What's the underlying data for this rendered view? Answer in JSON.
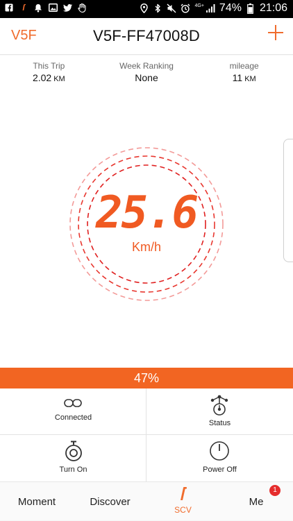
{
  "status_bar": {
    "battery_percent": "74%",
    "time": "21:06",
    "network": "4G+"
  },
  "header": {
    "left_label": "V5F",
    "title": "V5F-FF47008D"
  },
  "stats": [
    {
      "label": "This Trip",
      "value": "2.02",
      "unit": "KM"
    },
    {
      "label": "Week Ranking",
      "value": "None",
      "unit": ""
    },
    {
      "label": "mileage",
      "value": "11",
      "unit": "KM"
    }
  ],
  "speed": {
    "value": "25.6",
    "unit": "Km/h"
  },
  "battery": {
    "label": "47%",
    "level": 0.47
  },
  "controls": [
    {
      "label": "Connected",
      "icon": "link-icon"
    },
    {
      "label": "Status",
      "icon": "status-icon"
    },
    {
      "label": "Turn On",
      "icon": "stopwatch-icon"
    },
    {
      "label": "Power Off",
      "icon": "power-icon"
    }
  ],
  "nav": {
    "moment": "Moment",
    "discover": "Discover",
    "scv": "SCV",
    "me": "Me",
    "me_badge": "1"
  },
  "colors": {
    "accent": "#f06c2d",
    "speed": "#f05a22",
    "ring": "#e8362e",
    "battery_bar": "#f26522",
    "badge": "#e52d2d"
  }
}
